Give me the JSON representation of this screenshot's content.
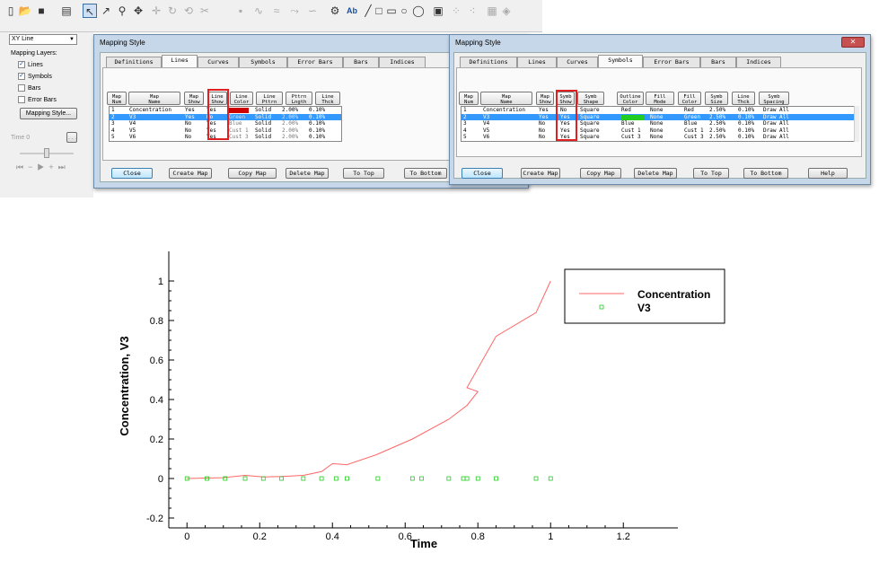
{
  "toolbar": {
    "icons": [
      "new-icon",
      "open-icon",
      "save-icon",
      "print-icon",
      "select-arrow-icon",
      "adjust-icon",
      "zoom-icon",
      "translate-icon",
      "probe-icon",
      "rotate-icon",
      "slice-icon",
      "streamtrace-icon",
      "text-icon",
      "line-icon",
      "rectangle-icon",
      "ellipse-icon",
      "circle-icon",
      "square-icon",
      "frame-icon",
      "grid-icon"
    ],
    "text_tool_label": "Ab"
  },
  "left_panel": {
    "plot_type": "XY Line",
    "mapping_layers_label": "Mapping Layers:",
    "layers": [
      {
        "label": "Lines",
        "checked": true
      },
      {
        "label": "Symbols",
        "checked": true
      },
      {
        "label": "Bars",
        "checked": false
      },
      {
        "label": "Error Bars",
        "checked": false
      }
    ],
    "mapping_style_button": "Mapping Style...",
    "time_label": "Time",
    "time_value": "0",
    "time_button": "..."
  },
  "dialog_lines": {
    "title": "Mapping Style",
    "tabs": [
      "Definitions",
      "Lines",
      "Curves",
      "Symbols",
      "Error Bars",
      "Bars",
      "Indices"
    ],
    "active_tab": "Lines",
    "columns": [
      "Map\nNum",
      "Map\nName",
      "Map\nShow",
      "Line\nShow",
      "Line\nColor",
      "Line\nPttrn",
      "Pttrn\nLngth",
      "Line\nThck"
    ],
    "rows": [
      {
        "num": "1",
        "name": "Concentration",
        "map_show": "Yes",
        "line_show": "Yes",
        "line_color": "",
        "line_color_hex": "#cc0000",
        "pattern": "Solid",
        "length": "2.00%",
        "thick": "0.10%"
      },
      {
        "num": "2",
        "name": "V3",
        "map_show": "Yes",
        "line_show": "No",
        "line_color": "Green",
        "line_color_hex": "",
        "pattern": "Solid",
        "length": "2.00%",
        "thick": "0.10%"
      },
      {
        "num": "3",
        "name": "V4",
        "map_show": "No",
        "line_show": "Yes",
        "line_color": "Blue",
        "line_color_hex": "",
        "pattern": "Solid",
        "length": "2.00%",
        "thick": "0.10%"
      },
      {
        "num": "4",
        "name": "V5",
        "map_show": "No",
        "line_show": "Yes",
        "line_color": "Cust 1",
        "line_color_hex": "",
        "pattern": "Solid",
        "length": "2.00%",
        "thick": "0.10%"
      },
      {
        "num": "5",
        "name": "V6",
        "map_show": "No",
        "line_show": "Yes",
        "line_color": "Cust 3",
        "line_color_hex": "",
        "pattern": "Solid",
        "length": "2.00%",
        "thick": "0.10%"
      }
    ],
    "buttons": [
      "Close",
      "Create Map",
      "Copy Map",
      "Delete Map",
      "To Top",
      "To Bottom"
    ]
  },
  "dialog_symbols": {
    "title": "Mapping Style",
    "tabs": [
      "Definitions",
      "Lines",
      "Curves",
      "Symbols",
      "Error Bars",
      "Bars",
      "Indices"
    ],
    "active_tab": "Symbols",
    "columns": [
      "Map\nNum",
      "Map\nName",
      "Map\nShow",
      "Symb\nShow",
      "Symb\nShape",
      "Outline\nColor",
      "Fill\nMode",
      "Fill\nColor",
      "Symb\nSize",
      "Line\nThck",
      "Symb\nSpacing"
    ],
    "rows": [
      {
        "num": "1",
        "name": "Concentration",
        "map_show": "Yes",
        "symb_show": "No",
        "shape": "Square",
        "outline": "Red",
        "outline_hex": "",
        "fill_mode": "None",
        "fill_color": "Red",
        "size": "2.50%",
        "thick": "0.10%",
        "spacing": "Draw All"
      },
      {
        "num": "2",
        "name": "V3",
        "map_show": "Yes",
        "symb_show": "Yes",
        "shape": "Square",
        "outline": "",
        "outline_hex": "#22cc22",
        "fill_mode": "None",
        "fill_color": "Green",
        "size": "2.50%",
        "thick": "0.10%",
        "spacing": "Draw All"
      },
      {
        "num": "3",
        "name": "V4",
        "map_show": "No",
        "symb_show": "Yes",
        "shape": "Square",
        "outline": "Blue",
        "outline_hex": "",
        "fill_mode": "None",
        "fill_color": "Blue",
        "size": "2.50%",
        "thick": "0.10%",
        "spacing": "Draw All"
      },
      {
        "num": "4",
        "name": "V5",
        "map_show": "No",
        "symb_show": "Yes",
        "shape": "Square",
        "outline": "Cust 1",
        "outline_hex": "",
        "fill_mode": "None",
        "fill_color": "Cust 1",
        "size": "2.50%",
        "thick": "0.10%",
        "spacing": "Draw All"
      },
      {
        "num": "5",
        "name": "V6",
        "map_show": "No",
        "symb_show": "Yes",
        "shape": "Square",
        "outline": "Cust 3",
        "outline_hex": "",
        "fill_mode": "None",
        "fill_color": "Cust 3",
        "size": "2.50%",
        "thick": "0.10%",
        "spacing": "Draw All"
      }
    ],
    "buttons": [
      "Close",
      "Create Map",
      "Copy Map",
      "Delete Map",
      "To Top",
      "To Bottom",
      "Help"
    ]
  },
  "chart_data": {
    "type": "line",
    "xlabel": "Time",
    "ylabel": "Concentration, V3",
    "xlim": [
      -0.05,
      1.35
    ],
    "ylim": [
      -0.25,
      1.15
    ],
    "x_ticks": [
      "0",
      "0.2",
      "0.4",
      "0.6",
      "0.8",
      "1",
      "1.2"
    ],
    "y_ticks": [
      "-0.2",
      "0",
      "0.2",
      "0.4",
      "0.6",
      "0.8",
      "1"
    ],
    "x_tick_values": [
      0,
      0.2,
      0.4,
      0.6,
      0.8,
      1,
      1.2
    ],
    "y_tick_values": [
      -0.2,
      0,
      0.2,
      0.4,
      0.6,
      0.8,
      1
    ],
    "grid": false,
    "legend_position": "top-right",
    "series": [
      {
        "name": "Concentration",
        "style": "line",
        "color": "#ff6666",
        "x": [
          0,
          0.05,
          0.1,
          0.16,
          0.21,
          0.26,
          0.32,
          0.37,
          0.4,
          0.44,
          0.52,
          0.62,
          0.72,
          0.77,
          0.8,
          0.77,
          0.85,
          0.96,
          1.0
        ],
        "y": [
          0,
          0.002,
          0.004,
          0.016,
          0.008,
          0.01,
          0.016,
          0.035,
          0.075,
          0.07,
          0.12,
          0.2,
          0.3,
          0.37,
          0.44,
          0.46,
          0.72,
          0.84,
          1.0
        ]
      },
      {
        "name": "V3",
        "style": "marker",
        "color": "#22cc22",
        "x": [
          0,
          0.055,
          0.105,
          0.16,
          0.21,
          0.26,
          0.32,
          0.37,
          0.41,
          0.44,
          0.525,
          0.62,
          0.645,
          0.72,
          0.76,
          0.77,
          0.8,
          0.85,
          0.96,
          1.0
        ],
        "y": [
          0,
          0,
          0,
          0,
          0,
          0,
          0,
          0,
          0,
          0,
          0,
          0,
          0,
          0,
          0,
          0,
          0,
          0,
          0,
          0
        ]
      }
    ]
  }
}
